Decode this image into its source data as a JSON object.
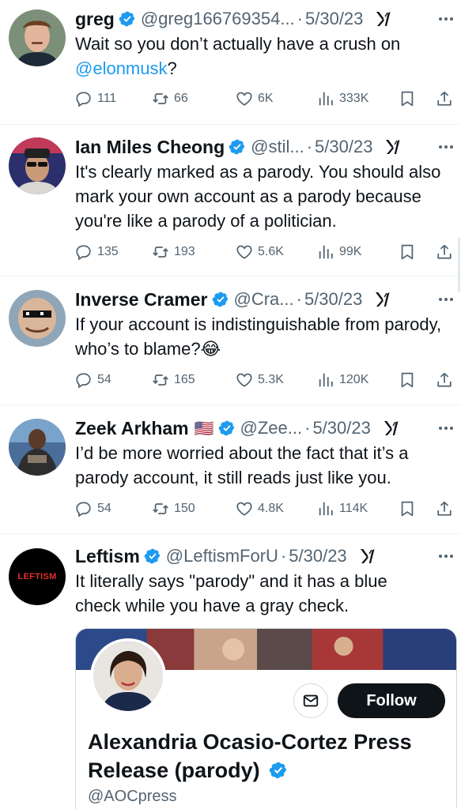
{
  "tweets": [
    {
      "name": "greg",
      "handle": "@greg166769354...",
      "dot": "·",
      "date": "5/30/23",
      "text_before": "Wait so you don’t actually have a crush on ",
      "mention": "@elonmusk",
      "text_after": "?",
      "replies": "111",
      "reposts": "66",
      "likes": "6K",
      "views": "333K"
    },
    {
      "name": "Ian Miles Cheong",
      "handle": "@stil...",
      "dot": "·",
      "date": "5/30/23",
      "text": "It's clearly marked as a parody. You should also mark your own account as a parody because you're like a parody of a politician.",
      "replies": "135",
      "reposts": "193",
      "likes": "5.6K",
      "views": "99K"
    },
    {
      "name": "Inverse Cramer",
      "handle": "@Cra...",
      "dot": "·",
      "date": "5/30/23",
      "text": "If your account is indistinguishable from parody, who’s to blame?😂",
      "replies": "54",
      "reposts": "165",
      "likes": "5.3K",
      "views": "120K"
    },
    {
      "name": "Zeek Arkham",
      "flag": "🇺🇸",
      "handle": "@Zee...",
      "dot": "·",
      "date": "5/30/23",
      "text": "I’d be more worried about the fact that it’s a parody account,  it still reads just like you.",
      "replies": "54",
      "reposts": "150",
      "likes": "4.8K",
      "views": "114K"
    },
    {
      "name": "Leftism",
      "avatar_text": "LEFTISM",
      "handle": "@LeftismForU",
      "dot": "·",
      "date": "5/30/23",
      "text": "It literally says \"parody\" and it has a blue check while you have a gray check."
    }
  ],
  "profile_card": {
    "follow_label": "Follow",
    "name": "Alexandria Ocasio-Cortez Press Release (parody)",
    "handle": "@AOCpress"
  },
  "colors": {
    "verified": "#1d9bf0",
    "secondary_text": "#536471",
    "mention": "#1d9bf0",
    "follow_button": "#0f1419"
  }
}
